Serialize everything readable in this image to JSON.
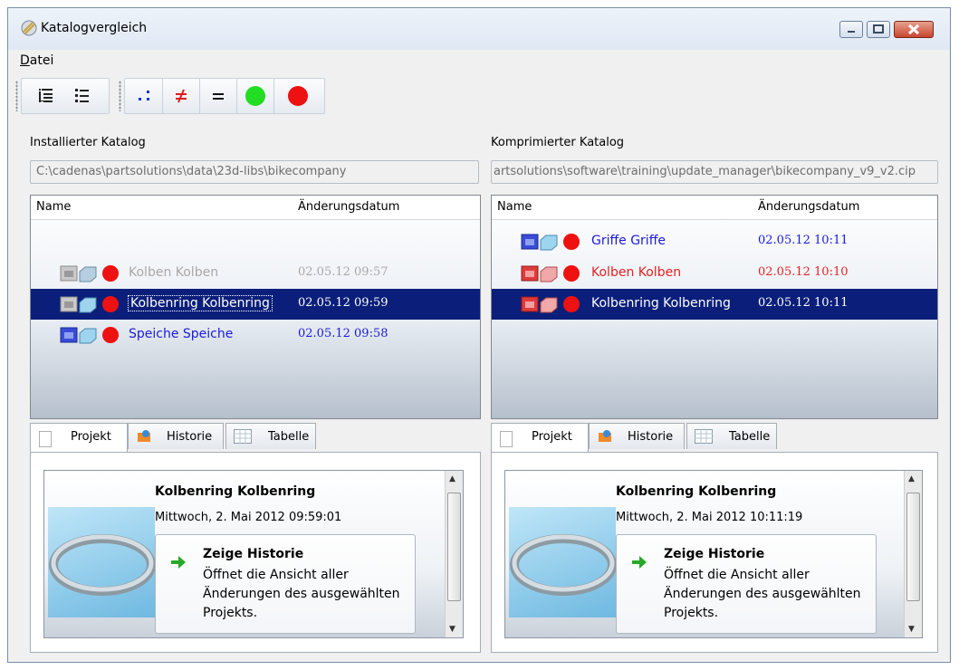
{
  "window": {
    "title": "Katalogvergleich",
    "controls": {
      "minimize": "minimize-icon",
      "maximize": "maximize-icon",
      "close": "close-icon"
    }
  },
  "menu": {
    "file_label": "Datei",
    "file_accel": "D",
    "file_rest": "atei"
  },
  "toolbar": {
    "buttons": [
      {
        "name": "tree-view-icon"
      },
      {
        "name": "list-view-icon"
      },
      {
        "name": "show-all-icon"
      },
      {
        "name": "show-different-icon"
      },
      {
        "name": "show-equal-icon"
      },
      {
        "name": "green-status-icon",
        "color": "#22dd22"
      },
      {
        "name": "red-status-icon",
        "color": "#ee1111"
      }
    ]
  },
  "left": {
    "label": "Installierter Katalog",
    "path": "C:\\cadenas\\partsolutions\\data\\23d-libs\\bikecompany",
    "columns": {
      "name": "Name",
      "date": "Änderungsdatum"
    },
    "rows": [
      {
        "name": "Kolben Kolben",
        "date": "02.05.12 09:57",
        "style": "gray",
        "selected": false
      },
      {
        "name": "Kolbenring Kolbenring",
        "date": "02.05.12 09:59",
        "style": "white",
        "selected": true
      },
      {
        "name": "Speiche Speiche",
        "date": "02.05.12 09:58",
        "style": "blue",
        "selected": false
      }
    ],
    "tabs": [
      "Projekt",
      "Historie",
      "Tabelle"
    ],
    "detail": {
      "title": "Kolbenring Kolbenring",
      "date": "Mittwoch, 2. Mai 2012 09:59:01",
      "history_title": "Zeige Historie",
      "history_desc": "Öffnet die Ansicht aller Änderungen des ausgewählten Projekts."
    }
  },
  "right": {
    "label": "Komprimierter Katalog",
    "path": "artsolutions\\software\\training\\update_manager\\bikecompany_v9_v2.cip",
    "columns": {
      "name": "Name",
      "date": "Änderungsdatum"
    },
    "rows": [
      {
        "name": "Griffe Griffe",
        "date": "02.05.12 10:11",
        "style": "blue",
        "selected": false
      },
      {
        "name": "Kolben Kolben",
        "date": "02.05.12 10:10",
        "style": "red",
        "selected": false
      },
      {
        "name": "Kolbenring Kolbenring",
        "date": "02.05.12 10:11",
        "style": "white",
        "selected": true
      }
    ],
    "tabs": [
      "Projekt",
      "Historie",
      "Tabelle"
    ],
    "detail": {
      "title": "Kolbenring Kolbenring",
      "date": "Mittwoch, 2. Mai 2012 10:11:19",
      "history_title": "Zeige Historie",
      "history_desc": "Öffnet die Ansicht aller Änderungen des ausgewählten Projekts."
    }
  },
  "colors": {
    "selection": "#0b1f7a",
    "changed_blue": "#1b1bd6",
    "deleted_red": "#e32222",
    "unchanged_gray": "#a8a8a8"
  }
}
